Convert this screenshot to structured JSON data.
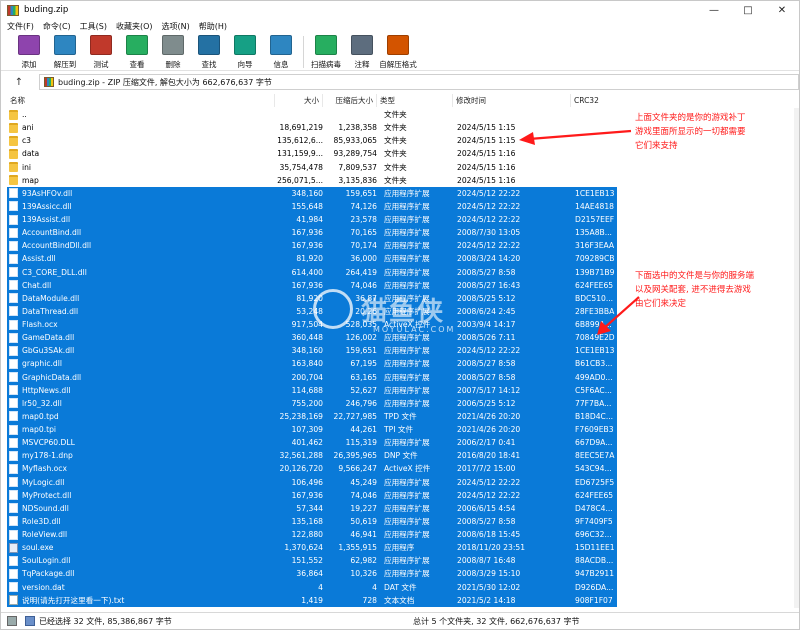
{
  "window": {
    "title": "buding.zip"
  },
  "menu": [
    "文件(F)",
    "命令(C)",
    "工具(S)",
    "收藏夹(O)",
    "选项(N)",
    "帮助(H)"
  ],
  "toolbar": [
    {
      "label": "添加",
      "icon": "add-icon",
      "color": "#8e44ad"
    },
    {
      "label": "解压到",
      "icon": "extract-icon",
      "color": "#2e86c1"
    },
    {
      "label": "测试",
      "icon": "test-icon",
      "color": "#c0392b"
    },
    {
      "label": "查看",
      "icon": "view-icon",
      "color": "#27ae60"
    },
    {
      "label": "删除",
      "icon": "delete-icon",
      "color": "#7f8c8d"
    },
    {
      "label": "查找",
      "icon": "find-icon",
      "color": "#2471a3"
    },
    {
      "label": "向导",
      "icon": "wizard-icon",
      "color": "#16a085"
    },
    {
      "label": "信息",
      "icon": "info-icon",
      "color": "#2e86c1"
    },
    {
      "label": "扫描病毒",
      "icon": "virus-scan-icon",
      "color": "#27ae60"
    },
    {
      "label": "注释",
      "icon": "comment-icon",
      "color": "#5d6d7e"
    },
    {
      "label": "自解压格式",
      "icon": "sfx-icon",
      "color": "#d35400"
    }
  ],
  "address": {
    "text": "buding.zip - ZIP 压缩文件, 解包大小为 662,676,637 字节"
  },
  "columns": {
    "name": "名称",
    "size": "大小",
    "packed": "压缩后大小",
    "type": "类型",
    "mtime": "修改时间",
    "crc": "CRC32"
  },
  "files": [
    {
      "name": "..",
      "size": "",
      "packed": "",
      "type": "文件夹",
      "mtime": "",
      "crc": "",
      "kind": "folder",
      "selected": false
    },
    {
      "name": "ani",
      "size": "18,691,219",
      "packed": "1,238,358",
      "type": "文件夹",
      "mtime": "2024/5/15 1:15",
      "crc": "",
      "kind": "folder",
      "selected": false
    },
    {
      "name": "c3",
      "size": "135,612,6...",
      "packed": "85,933,065",
      "type": "文件夹",
      "mtime": "2024/5/15 1:15",
      "crc": "",
      "kind": "folder",
      "selected": false
    },
    {
      "name": "data",
      "size": "131,159,9...",
      "packed": "93,289,754",
      "type": "文件夹",
      "mtime": "2024/5/15 1:16",
      "crc": "",
      "kind": "folder",
      "selected": false
    },
    {
      "name": "ini",
      "size": "35,754,478",
      "packed": "7,809,537",
      "type": "文件夹",
      "mtime": "2024/5/15 1:16",
      "crc": "",
      "kind": "folder",
      "selected": false
    },
    {
      "name": "map",
      "size": "256,071,5...",
      "packed": "3,135,836",
      "type": "文件夹",
      "mtime": "2024/5/15 1:16",
      "crc": "",
      "kind": "folder",
      "selected": false
    },
    {
      "name": "93AsHFOv.dll",
      "size": "348,160",
      "packed": "159,651",
      "type": "应用程序扩展",
      "mtime": "2024/5/12 22:22",
      "crc": "1CE1EB13",
      "kind": "file",
      "selected": true
    },
    {
      "name": "139Assicc.dll",
      "size": "155,648",
      "packed": "74,126",
      "type": "应用程序扩展",
      "mtime": "2024/5/12 22:22",
      "crc": "14AE4818",
      "kind": "file",
      "selected": true
    },
    {
      "name": "139Assist.dll",
      "size": "41,984",
      "packed": "23,578",
      "type": "应用程序扩展",
      "mtime": "2024/5/12 22:22",
      "crc": "D2157EEF",
      "kind": "file",
      "selected": true
    },
    {
      "name": "AccountBind.dll",
      "size": "167,936",
      "packed": "70,165",
      "type": "应用程序扩展",
      "mtime": "2008/7/30 13:05",
      "crc": "135A8B...",
      "kind": "file",
      "selected": true
    },
    {
      "name": "AccountBindDll.dll",
      "size": "167,936",
      "packed": "70,174",
      "type": "应用程序扩展",
      "mtime": "2024/5/12 22:22",
      "crc": "316F3EAA",
      "kind": "file",
      "selected": true
    },
    {
      "name": "Assist.dll",
      "size": "81,920",
      "packed": "36,000",
      "type": "应用程序扩展",
      "mtime": "2008/3/24 14:20",
      "crc": "709289CB",
      "kind": "file",
      "selected": true
    },
    {
      "name": "C3_CORE_DLL.dll",
      "size": "614,400",
      "packed": "264,419",
      "type": "应用程序扩展",
      "mtime": "2008/5/27 8:58",
      "crc": "139B71B9",
      "kind": "file",
      "selected": true
    },
    {
      "name": "Chat.dll",
      "size": "167,936",
      "packed": "74,046",
      "type": "应用程序扩展",
      "mtime": "2008/5/27 16:43",
      "crc": "624FEE65",
      "kind": "file",
      "selected": true
    },
    {
      "name": "DataModule.dll",
      "size": "81,920",
      "packed": "36,87",
      "type": "应用程序扩展",
      "mtime": "2008/5/25 5:12",
      "crc": "BDC510...",
      "kind": "file",
      "selected": true
    },
    {
      "name": "DataThread.dll",
      "size": "53,248",
      "packed": "20,26",
      "type": "应用程序扩展",
      "mtime": "2008/6/24 2:45",
      "crc": "28FE3BBA",
      "kind": "file",
      "selected": true
    },
    {
      "name": "Flash.ocx",
      "size": "917,504",
      "packed": "528,035",
      "type": "ActiveX 控件",
      "mtime": "2003/9/4 14:17",
      "crc": "6B899A...",
      "kind": "file",
      "selected": true
    },
    {
      "name": "GameData.dll",
      "size": "360,448",
      "packed": "126,002",
      "type": "应用程序扩展",
      "mtime": "2008/5/26 7:11",
      "crc": "70849E2D",
      "kind": "file",
      "selected": true
    },
    {
      "name": "GbGu3SAk.dll",
      "size": "348,160",
      "packed": "159,651",
      "type": "应用程序扩展",
      "mtime": "2024/5/12 22:22",
      "crc": "1CE1EB13",
      "kind": "file",
      "selected": true
    },
    {
      "name": "graphic.dll",
      "size": "163,840",
      "packed": "67,195",
      "type": "应用程序扩展",
      "mtime": "2008/5/27 8:58",
      "crc": "B61CB3...",
      "kind": "file",
      "selected": true
    },
    {
      "name": "GraphicData.dll",
      "size": "200,704",
      "packed": "63,165",
      "type": "应用程序扩展",
      "mtime": "2008/5/27 8:58",
      "crc": "499AD0...",
      "kind": "file",
      "selected": true
    },
    {
      "name": "HttpNews.dll",
      "size": "114,688",
      "packed": "52,627",
      "type": "应用程序扩展",
      "mtime": "2007/5/17 14:12",
      "crc": "C5F6AC...",
      "kind": "file",
      "selected": true
    },
    {
      "name": "lr50_32.dll",
      "size": "755,200",
      "packed": "246,796",
      "type": "应用程序扩展",
      "mtime": "2006/5/25 5:12",
      "crc": "77F7BA...",
      "kind": "file",
      "selected": true
    },
    {
      "name": "map0.tpd",
      "size": "25,238,169",
      "packed": "22,727,985",
      "type": "TPD 文件",
      "mtime": "2021/4/26 20:20",
      "crc": "B18D4C...",
      "kind": "file",
      "selected": true
    },
    {
      "name": "map0.tpi",
      "size": "107,309",
      "packed": "44,261",
      "type": "TPI 文件",
      "mtime": "2021/4/26 20:20",
      "crc": "F7609EB3",
      "kind": "file",
      "selected": true
    },
    {
      "name": "MSVCP60.DLL",
      "size": "401,462",
      "packed": "115,319",
      "type": "应用程序扩展",
      "mtime": "2006/2/17 0:41",
      "crc": "667D9A...",
      "kind": "file",
      "selected": true
    },
    {
      "name": "my178-1.dnp",
      "size": "32,561,288",
      "packed": "26,395,965",
      "type": "DNP 文件",
      "mtime": "2016/8/20 18:41",
      "crc": "8EEC5E7A",
      "kind": "file",
      "selected": true
    },
    {
      "name": "Myflash.ocx",
      "size": "20,126,720",
      "packed": "9,566,247",
      "type": "ActiveX 控件",
      "mtime": "2017/7/2 15:00",
      "crc": "543C94...",
      "kind": "file",
      "selected": true
    },
    {
      "name": "MyLogic.dll",
      "size": "106,496",
      "packed": "45,249",
      "type": "应用程序扩展",
      "mtime": "2024/5/12 22:22",
      "crc": "ED6725F5",
      "kind": "file",
      "selected": true
    },
    {
      "name": "MyProtect.dll",
      "size": "167,936",
      "packed": "74,046",
      "type": "应用程序扩展",
      "mtime": "2024/5/12 22:22",
      "crc": "624FEE65",
      "kind": "file",
      "selected": true
    },
    {
      "name": "NDSound.dll",
      "size": "57,344",
      "packed": "19,227",
      "type": "应用程序扩展",
      "mtime": "2006/6/15 4:54",
      "crc": "D478C4...",
      "kind": "file",
      "selected": true
    },
    {
      "name": "Role3D.dll",
      "size": "135,168",
      "packed": "50,619",
      "type": "应用程序扩展",
      "mtime": "2008/5/27 8:58",
      "crc": "9F7409F5",
      "kind": "file",
      "selected": true
    },
    {
      "name": "RoleView.dll",
      "size": "122,880",
      "packed": "46,941",
      "type": "应用程序扩展",
      "mtime": "2008/6/18 15:45",
      "crc": "696C32...",
      "kind": "file",
      "selected": true
    },
    {
      "name": "soul.exe",
      "size": "1,370,624",
      "packed": "1,355,915",
      "type": "应用程序",
      "mtime": "2018/11/20 23:51",
      "crc": "15D11EE1",
      "kind": "exe",
      "selected": true
    },
    {
      "name": "SoulLogin.dll",
      "size": "151,552",
      "packed": "62,982",
      "type": "应用程序扩展",
      "mtime": "2008/8/7 16:48",
      "crc": "88ACDB...",
      "kind": "file",
      "selected": true
    },
    {
      "name": "TqPackage.dll",
      "size": "36,864",
      "packed": "10,326",
      "type": "应用程序扩展",
      "mtime": "2008/3/29 15:10",
      "crc": "947B2911",
      "kind": "file",
      "selected": true
    },
    {
      "name": "version.dat",
      "size": "4",
      "packed": "4",
      "type": "DAT 文件",
      "mtime": "2021/5/30 12:02",
      "crc": "D926DA...",
      "kind": "file",
      "selected": true
    },
    {
      "name": "说明(请先打开这里看一下).txt",
      "size": "1,419",
      "packed": "728",
      "type": "文本文档",
      "mtime": "2021/5/2 14:18",
      "crc": "908F1F07",
      "kind": "txt",
      "selected": true
    }
  ],
  "status": {
    "left": "已经选择 32 文件, 85,386,867 字节",
    "right": "总计 5 个文件夹, 32 文件, 662,676,637 字节"
  },
  "annotations": {
    "note1": [
      "上面文件夹的是你的游戏补丁",
      "游戏里面所显示的一切都需要",
      "它们来支持"
    ],
    "note2": [
      "下面选中的文件是与你的服务端",
      "以及网关配套, 进不进得去游戏",
      "由它们来决定"
    ]
  },
  "watermark": {
    "text": "猫鱼侠",
    "sub": "MOYULAC.COM"
  },
  "colors": {
    "selection": "#0a7ad8",
    "annotation": "#ff1a1a"
  }
}
